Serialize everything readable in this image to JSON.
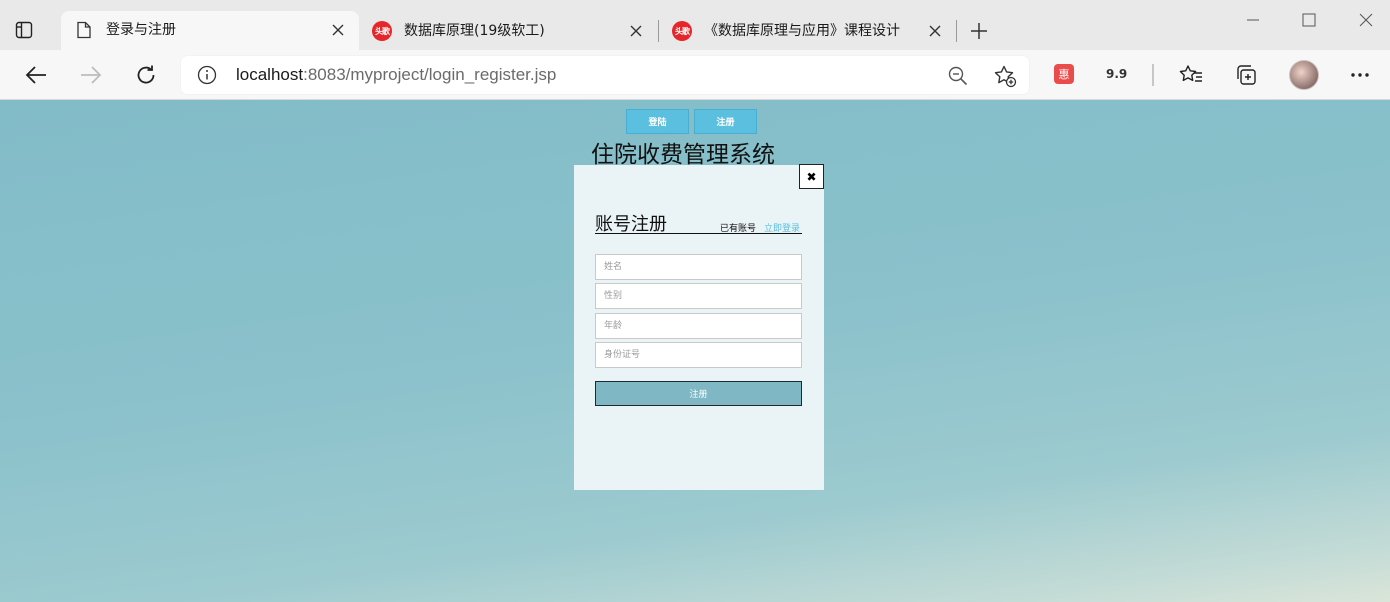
{
  "browser": {
    "tabs": [
      {
        "title": "登录与注册",
        "icon": "page-icon",
        "active": true
      },
      {
        "title": "数据库原理(19级软工)",
        "icon": "toutiao-icon",
        "icon_text": "头歌",
        "active": false
      },
      {
        "title": "《数据库原理与应用》课程设计",
        "icon": "toutiao-icon",
        "icon_text": "头歌",
        "active": false
      }
    ],
    "url_host": "localhost",
    "url_rest": ":8083/myproject/login_register.jsp",
    "extensions": {
      "hui_label": "惠",
      "badge_label": "9.9"
    }
  },
  "page": {
    "top_buttons": {
      "login": "登陆",
      "register": "注册"
    },
    "system_title": "住院收费管理系统",
    "panel": {
      "close_label": "✖",
      "title": "账号注册",
      "have_account": "已有账号",
      "login_link": "立即登录",
      "fields": {
        "name_placeholder": "姓名",
        "gender_placeholder": "性别",
        "age_placeholder": "年龄",
        "id_placeholder": "身份证号"
      },
      "submit_label": "注册"
    },
    "colors": {
      "accent_button": "#5bbfe0",
      "submit_button": "#7fb8c4",
      "background_top": "#82bcc8",
      "background_bottom": "#dae5d9"
    }
  }
}
